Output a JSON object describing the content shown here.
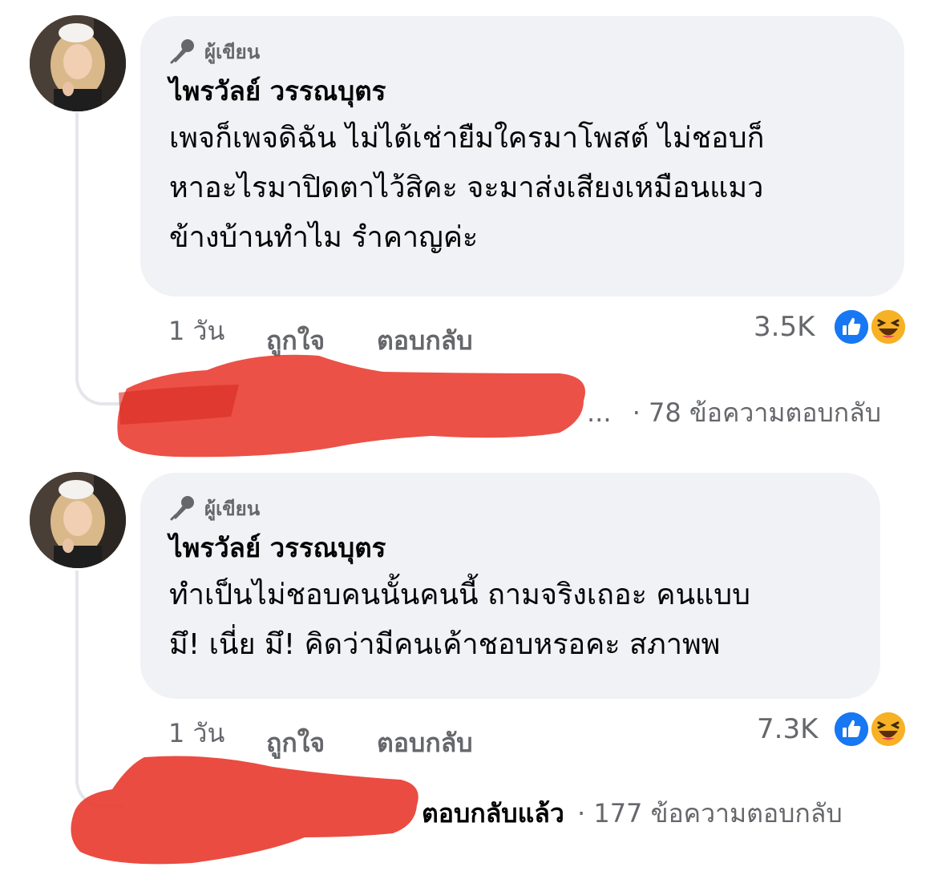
{
  "comments": [
    {
      "badge": "ผู้เขียน",
      "author": "ไพรวัลย์ วรรณบุตร",
      "lines": [
        "เพจก็เพจดิฉัน ไม่ได้เช่ายืมใครมาโพสต์ ไม่ชอบก็",
        "หาอะไรมาปิดตาไว้สิคะ จะมาส่งเสียงเหมือนแมว",
        "ข้างบ้านทำไม รำคาญค่ะ"
      ],
      "time": "1 วัน",
      "like_label": "ถูกใจ",
      "reply_label": "ตอบกลับ",
      "reaction_count": "3.5K",
      "reactions": [
        "like-icon",
        "haha-icon"
      ],
      "replies_prefix": "...",
      "replies_replied": "",
      "replies_count": "· 78 ข้อความตอบกลับ"
    },
    {
      "badge": "ผู้เขียน",
      "author": "ไพรวัลย์ วรรณบุตร",
      "lines": [
        "ทำเป็นไม่ชอบคนนั้นคนนี้ ถามจริงเถอะ คนแบบ",
        "มึ! เนี่ย มึ! คิดว่ามีคนเค้าชอบหรอคะ สภาพพ"
      ],
      "time": "1 วัน",
      "like_label": "ถูกใจ",
      "reply_label": "ตอบกลับ",
      "reaction_count": "7.3K",
      "reactions": [
        "like-icon",
        "haha-icon"
      ],
      "replies_prefix": "",
      "replies_replied": "ตอบกลับแล้ว",
      "replies_count": "· 177 ข้อความตอบกลับ"
    }
  ],
  "colors": {
    "bubble": "#f0f2f5",
    "meta": "#65676b",
    "like_blue": "#1877f2",
    "haha_yellow": "#f7b125",
    "redaction": "#e8392e"
  }
}
